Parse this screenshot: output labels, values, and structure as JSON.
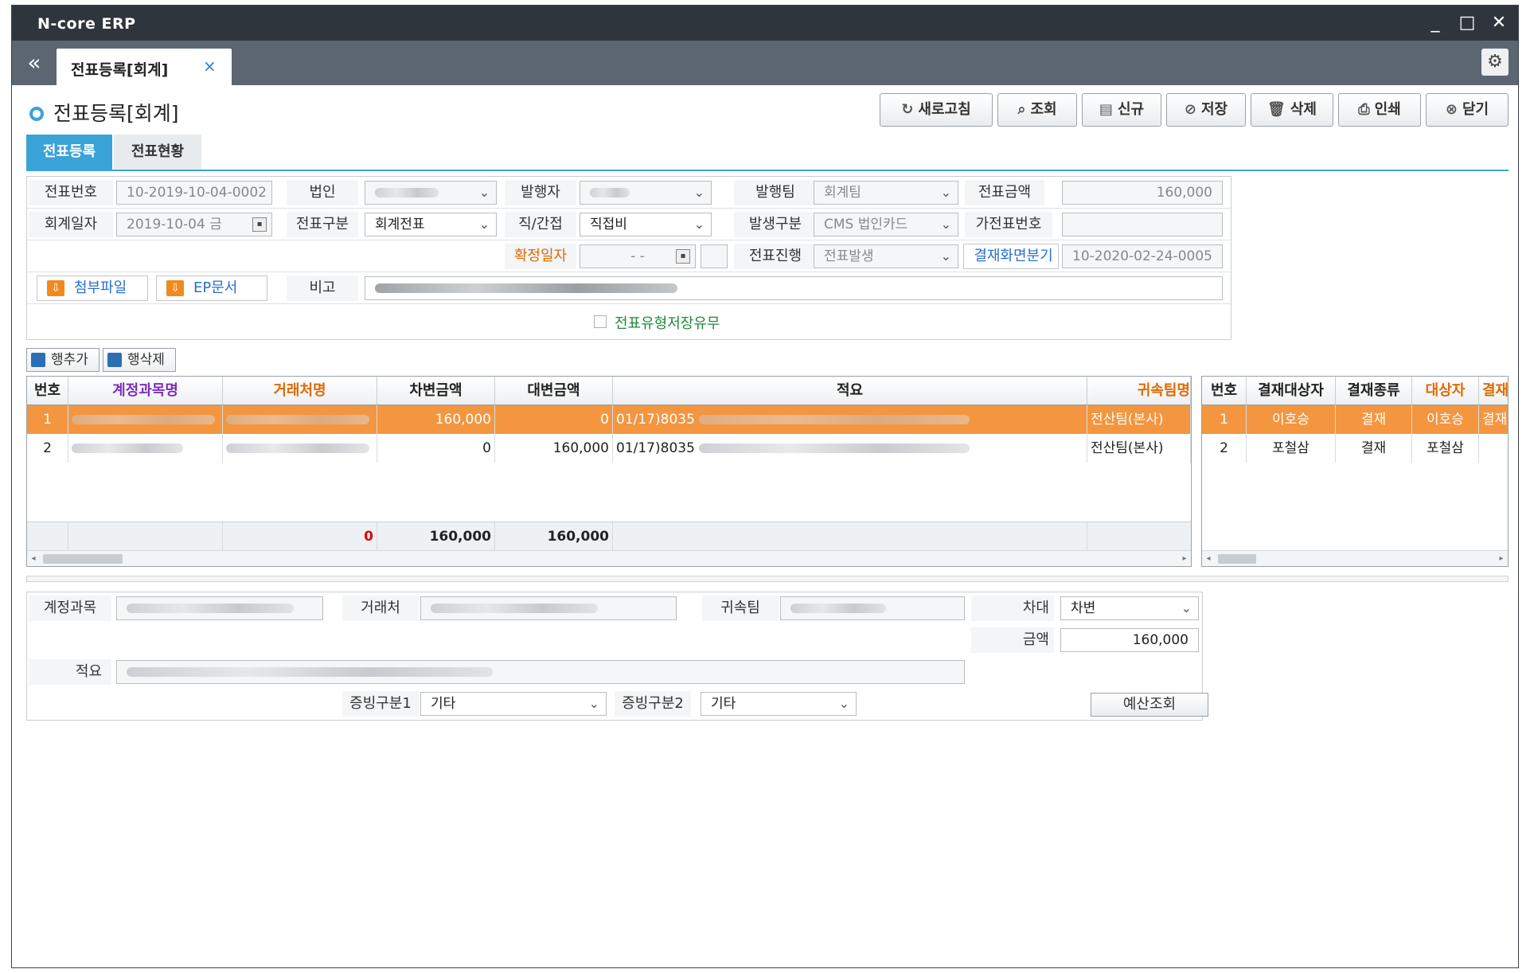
{
  "app": {
    "title": "N-core ERP"
  },
  "window_controls": {
    "minimize": "_",
    "maximize": "□",
    "close": "✕"
  },
  "tabs": {
    "collapse": "«",
    "active_tab": "전표등록[회계]",
    "close": "×"
  },
  "page": {
    "title": "전표등록[회계]"
  },
  "toolbar": {
    "refresh": "새로고침",
    "search": "조회",
    "new": "신규",
    "save": "저장",
    "delete": "삭제",
    "print": "인쇄",
    "close": "닫기"
  },
  "subtabs": {
    "register": "전표등록",
    "status": "전표현황"
  },
  "form": {
    "voucher_no_label": "전표번호",
    "voucher_no": "10-2019-10-04-0002",
    "corp_label": "법인",
    "issuer_label": "발행자",
    "issue_team_label": "발행팀",
    "issue_team": "회계팀",
    "voucher_amount_label": "전표금액",
    "voucher_amount": "160,000",
    "acct_date_label": "회계일자",
    "acct_date": "2019-10-04 금",
    "voucher_type_label": "전표구분",
    "voucher_type": "회계전표",
    "direct_label": "직/간접",
    "direct": "직접비",
    "occur_type_label": "발생구분",
    "occur_type": "CMS 법인카드",
    "temp_no_label": "가전표번호",
    "confirm_date_label": "확정일자",
    "confirm_date": "- -",
    "progress_label": "전표진행",
    "progress": "전표발생",
    "approval_split_button": "결재화면분기",
    "approval_split_no": "10-2020-02-24-0005",
    "attach_button": "첨부파일",
    "ep_button": "EP문서",
    "remark_label": "비고",
    "save_type_label": "전표유형저장유무"
  },
  "row_buttons": {
    "add": "행추가",
    "delete": "행삭제"
  },
  "main_grid": {
    "headers": [
      "번호",
      "계정과목명",
      "거래처명",
      "차변금액",
      "대변금액",
      "적요",
      "귀속팀명"
    ],
    "rows": [
      {
        "no": "1",
        "debit": "160,000",
        "credit": "0",
        "memo_prefix": "01/17)8035",
        "team": "전산팀(본사)"
      },
      {
        "no": "2",
        "debit": "0",
        "credit": "160,000",
        "memo_prefix": "01/17)8035",
        "team": "전산팀(본사)"
      }
    ],
    "sum": {
      "diff": "0",
      "debit": "160,000",
      "credit": "160,000"
    }
  },
  "approval_grid": {
    "headers": [
      "번호",
      "결재대상자",
      "결재종류",
      "대상자",
      "결재"
    ],
    "rows": [
      {
        "no": "1",
        "target": "이호승",
        "kind": "결재",
        "person": "이호승",
        "extra": "결재"
      },
      {
        "no": "2",
        "target": "포철삼",
        "kind": "결재",
        "person": "포철삼",
        "extra": ""
      }
    ]
  },
  "detail": {
    "account_label": "계정과목",
    "vendor_label": "거래처",
    "team_label": "귀속팀",
    "dc_label": "차대",
    "dc_value": "차변",
    "amount_label": "금액",
    "amount": "160,000",
    "memo_label": "적요",
    "evidence1_label": "증빙구분1",
    "evidence1": "기타",
    "evidence2_label": "증빙구분2",
    "evidence2": "기타",
    "budget_button": "예산조회"
  },
  "colors": {
    "accent": "#3aa3d8",
    "selected_row": "#f3963f",
    "titlebar": "#2f353d",
    "tabbar": "#5b6672"
  }
}
